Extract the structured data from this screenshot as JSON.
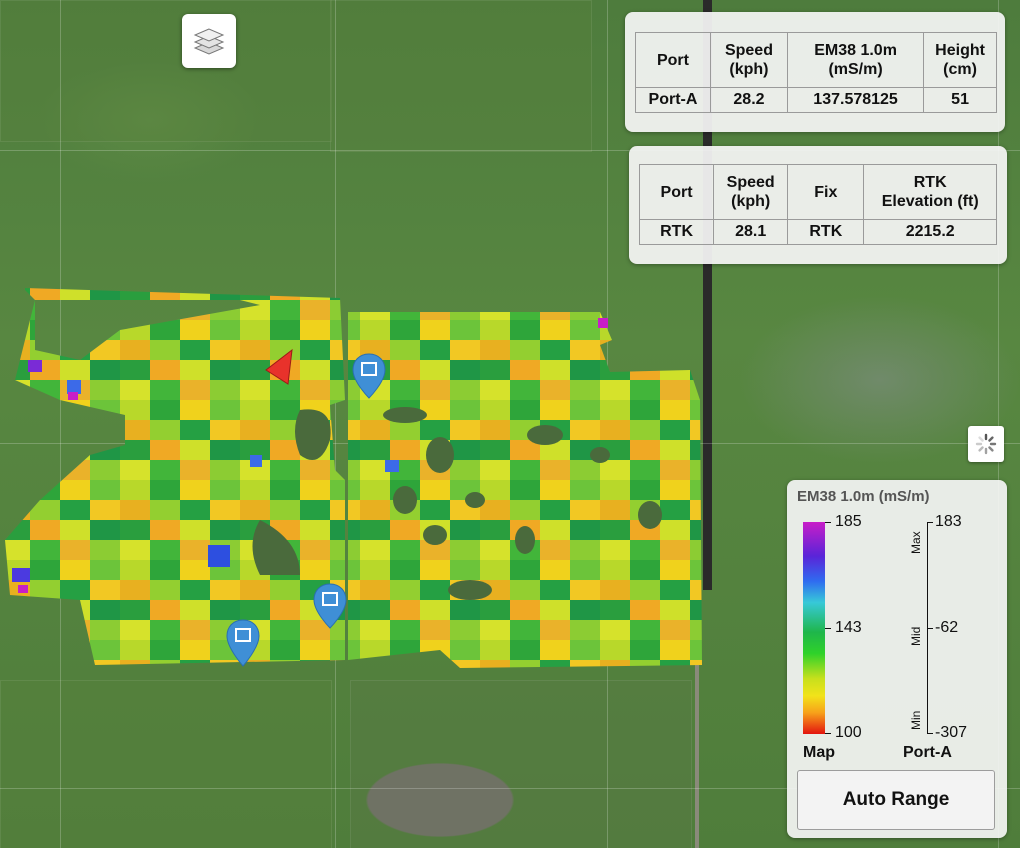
{
  "map": {
    "layers_icon": "layers-icon",
    "loading_icon": "spinner-icon",
    "heading_marker_icon": "triangle-arrow-icon",
    "flag_icon": "map-pin-icon"
  },
  "port_a_panel": {
    "headers": [
      "Port",
      "Speed\n(kph)",
      "EM38 1.0m\n(mS/m)",
      "Height\n(cm)"
    ],
    "row": [
      "Port-A",
      "28.2",
      "137.578125",
      "51"
    ]
  },
  "rtk_panel": {
    "headers": [
      "Port",
      "Speed\n(kph)",
      "Fix",
      "RTK\nElevation (ft)"
    ],
    "row": [
      "RTK",
      "28.1",
      "RTK",
      "2215.2"
    ]
  },
  "legend": {
    "title": "EM38 1.0m (mS/m)",
    "map_max": "185",
    "map_mid": "143",
    "map_min": "100",
    "axis_max": "183",
    "axis_mid": "-62",
    "axis_min": "-307",
    "word_max": "Max",
    "word_mid": "Mid",
    "word_min": "Min",
    "foot_left": "Map",
    "foot_right": "Port-A",
    "auto_range_label": "Auto Range"
  },
  "colors": {
    "high": "#c81ec8",
    "mid": "#1fb64b",
    "low": "#e3140f",
    "pin": "#3f8fd6",
    "marker": "#e8322b"
  }
}
